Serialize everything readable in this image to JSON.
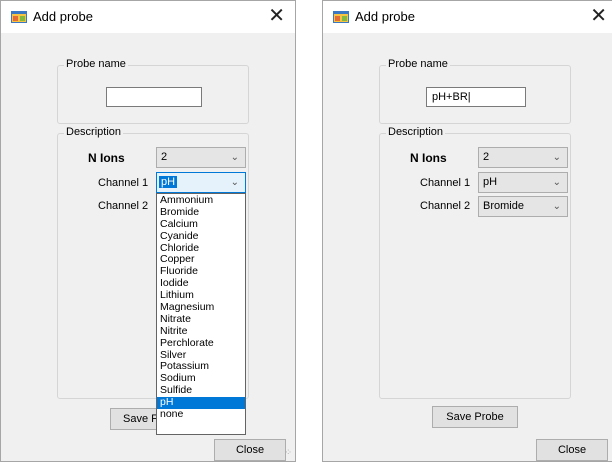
{
  "left_window": {
    "title": "Add probe",
    "close_glyph": "✕",
    "probe_name_group": "Probe name",
    "probe_name_value": "",
    "description_group": "Description",
    "n_ions_label": "N Ions",
    "n_ions_value": "2",
    "channel1_label": "Channel 1",
    "channel1_value": "pH",
    "channel2_label": "Channel 2",
    "save_label_visible": "Save F",
    "close_label": "Close",
    "dropdown_options": [
      "Ammonium",
      "Bromide",
      "Calcium",
      "Cyanide",
      "Chloride",
      "Copper",
      "Fluoride",
      "Iodide",
      "Lithium",
      "Magnesium",
      "Nitrate",
      "Nitrite",
      "Perchlorate",
      "Silver",
      "Potassium",
      "Sodium",
      "Sulfide",
      "pH",
      "none"
    ],
    "dropdown_selected": "pH"
  },
  "right_window": {
    "title": "Add probe",
    "close_glyph": "✕",
    "probe_name_group": "Probe name",
    "probe_name_value": "pH+BR|",
    "description_group": "Description",
    "n_ions_label": "N Ions",
    "n_ions_value": "2",
    "channel1_label": "Channel 1",
    "channel1_value": "pH",
    "channel2_label": "Channel 2",
    "channel2_value": "Bromide",
    "save_label": "Save Probe",
    "close_label": "Close"
  },
  "icons": {
    "app": "form-app-icon",
    "dropdown_arrow": "chevron-down-icon",
    "close": "close-icon",
    "resize": "resize-grip-icon"
  },
  "colors": {
    "window_bg": "#f0f0f0",
    "accent": "#0078d7",
    "button_bg": "#e1e1e1"
  }
}
